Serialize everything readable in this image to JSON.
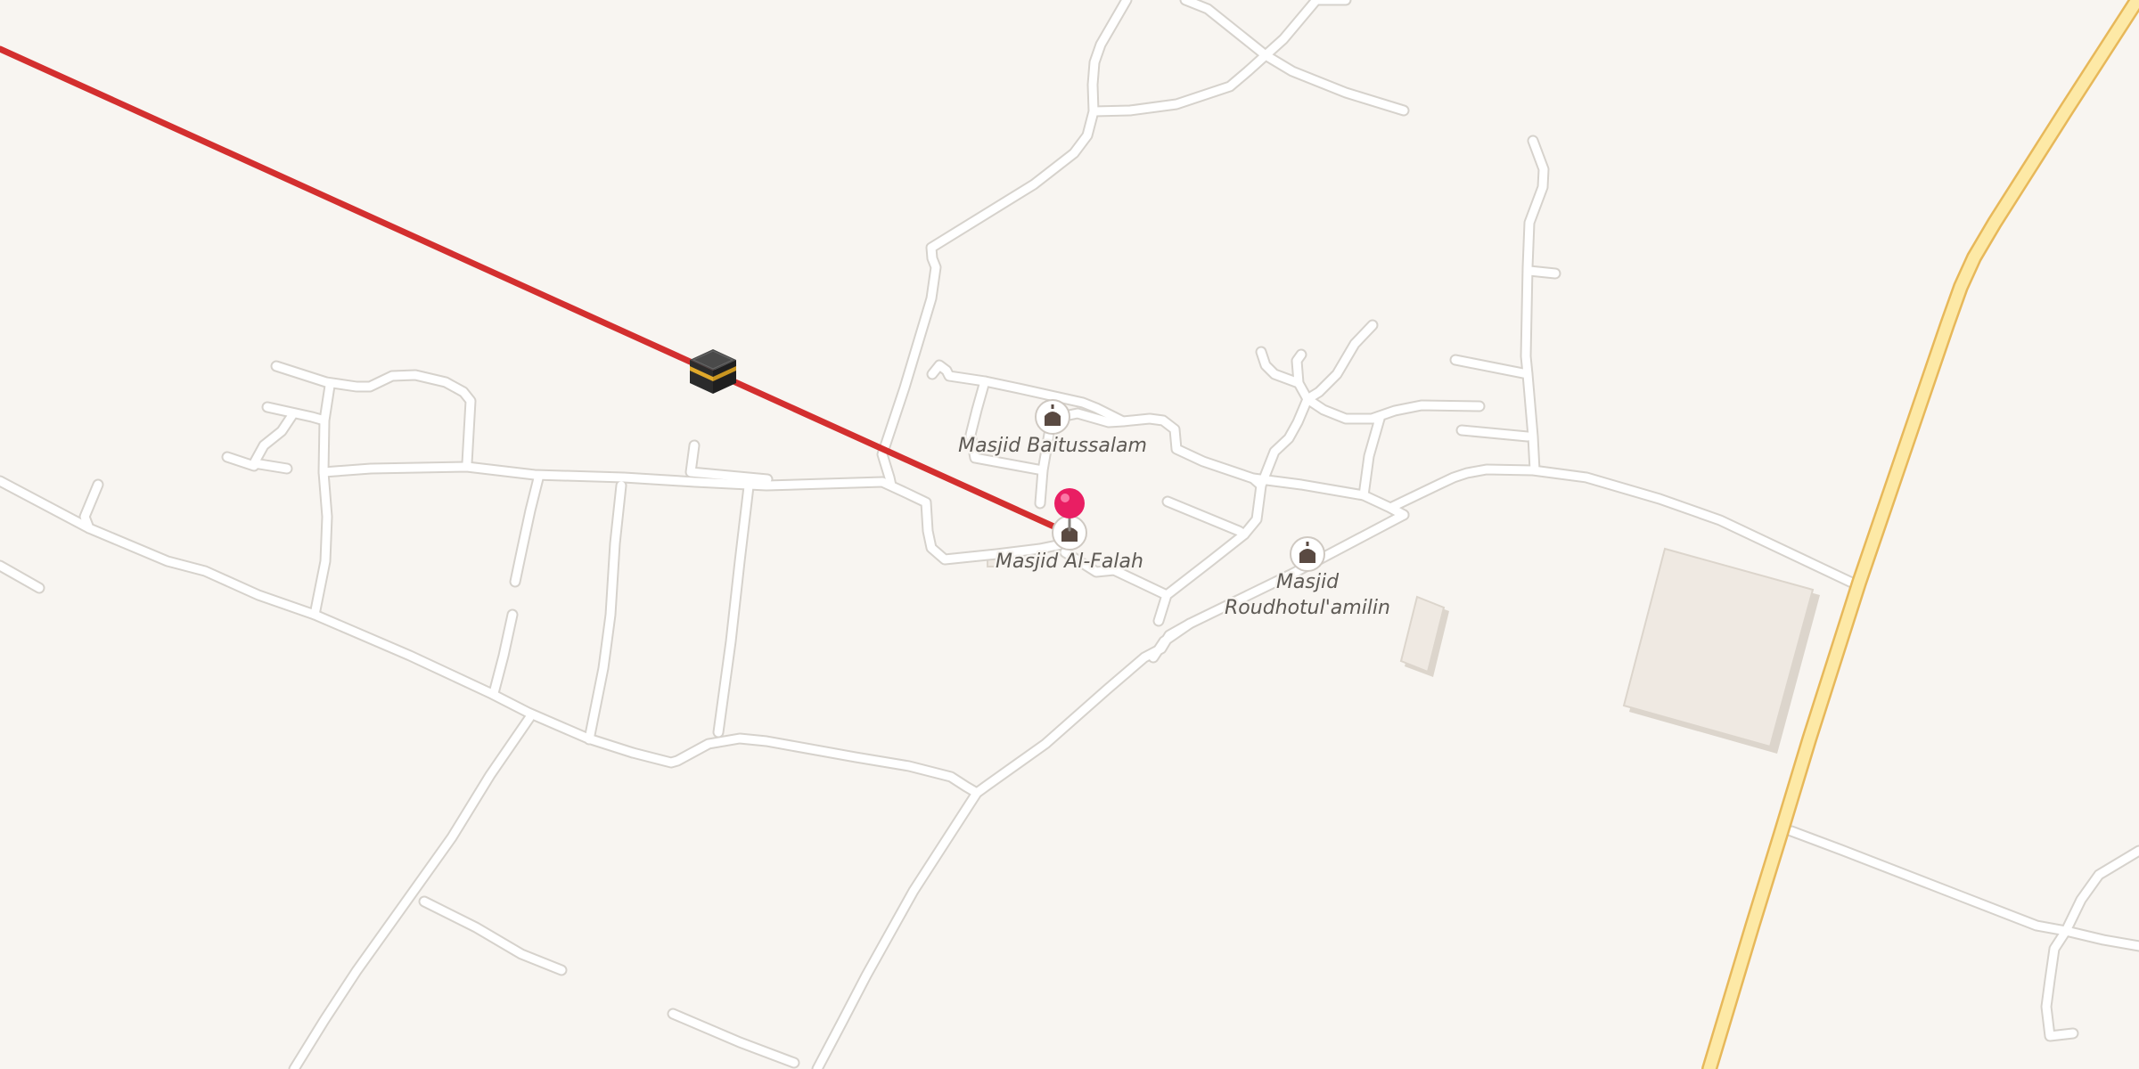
{
  "map": {
    "colors": {
      "background": "#f8f5f1",
      "road": "#ffffff",
      "road_casing": "#d6d2cc",
      "major_road": "#fde9a6",
      "major_road_casing": "#e7b85a",
      "qibla_line": "#d32f2f",
      "location_pin": "#e91e63",
      "poi_icon": "#5a4a42"
    },
    "qibla_line": {
      "icon": "kaaba-icon"
    },
    "location_marker": {
      "icon": "location-pin-icon"
    },
    "pois": [
      {
        "name": "Masjid Baitussalam",
        "icon": "mosque-icon"
      },
      {
        "name": "Masjid Al-Falah",
        "icon": "mosque-icon"
      },
      {
        "name_line1": "Masjid",
        "name_line2": "Roudhotul'amilin",
        "icon": "mosque-icon"
      }
    ]
  }
}
